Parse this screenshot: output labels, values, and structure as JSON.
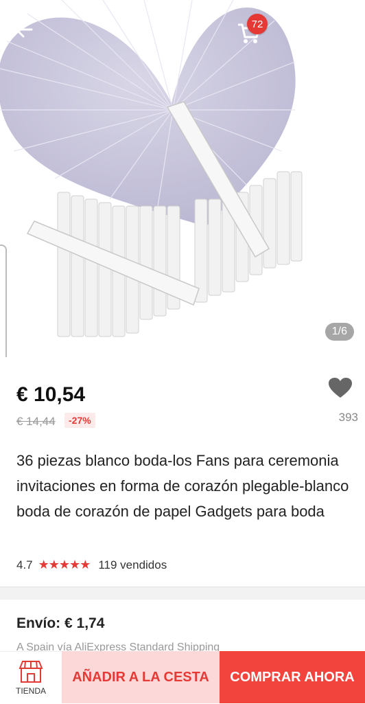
{
  "header": {
    "cart_count": "72",
    "image_counter": "1/6"
  },
  "product": {
    "price": "€ 10,54",
    "old_price": "€ 14,44",
    "discount": "-27%",
    "wishlist_count": "393",
    "title": "36 piezas blanco boda-los Fans para ceremonia invitaciones en forma de corazón plegable-blanco boda de corazón de papel Gadgets para boda",
    "rating": "4.7",
    "sold": "119 vendidos"
  },
  "shipping": {
    "label": "Envío: € 1,74",
    "sub": "A Spain vía AliExpress Standard Shipping"
  },
  "bottom_bar": {
    "store_label": "TIENDA",
    "add_to_cart": "AÑADIR A LA CESTA",
    "buy_now": "COMPRAR AHORA"
  },
  "colors": {
    "accent": "#e53935",
    "buy_button": "#f2433d",
    "add_cart_bg": "#fdd8d8"
  }
}
